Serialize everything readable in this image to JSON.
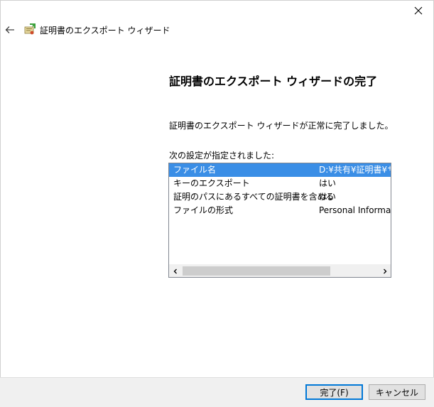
{
  "window": {
    "header_title": "証明書のエクスポート ウィザード"
  },
  "main": {
    "title": "証明書のエクスポート ウィザードの完了",
    "success_message": "証明書のエクスポート ウィザードが正常に完了しました。",
    "settings_label": "次の設定が指定されました:"
  },
  "settings": [
    {
      "name": "ファイル名",
      "value": "D:¥共有¥証明書¥サー"
    },
    {
      "name": "キーのエクスポート",
      "value": "はい"
    },
    {
      "name": "証明のパスにあるすべての証明書を含める",
      "value": "はい"
    },
    {
      "name": "ファイルの形式",
      "value": "Personal Informatio"
    }
  ],
  "footer": {
    "finish_label": "完了(F)",
    "cancel_label": "キャンセル"
  },
  "colors": {
    "selection": "#3a8ee6",
    "default_button_border": "#0078d7"
  }
}
